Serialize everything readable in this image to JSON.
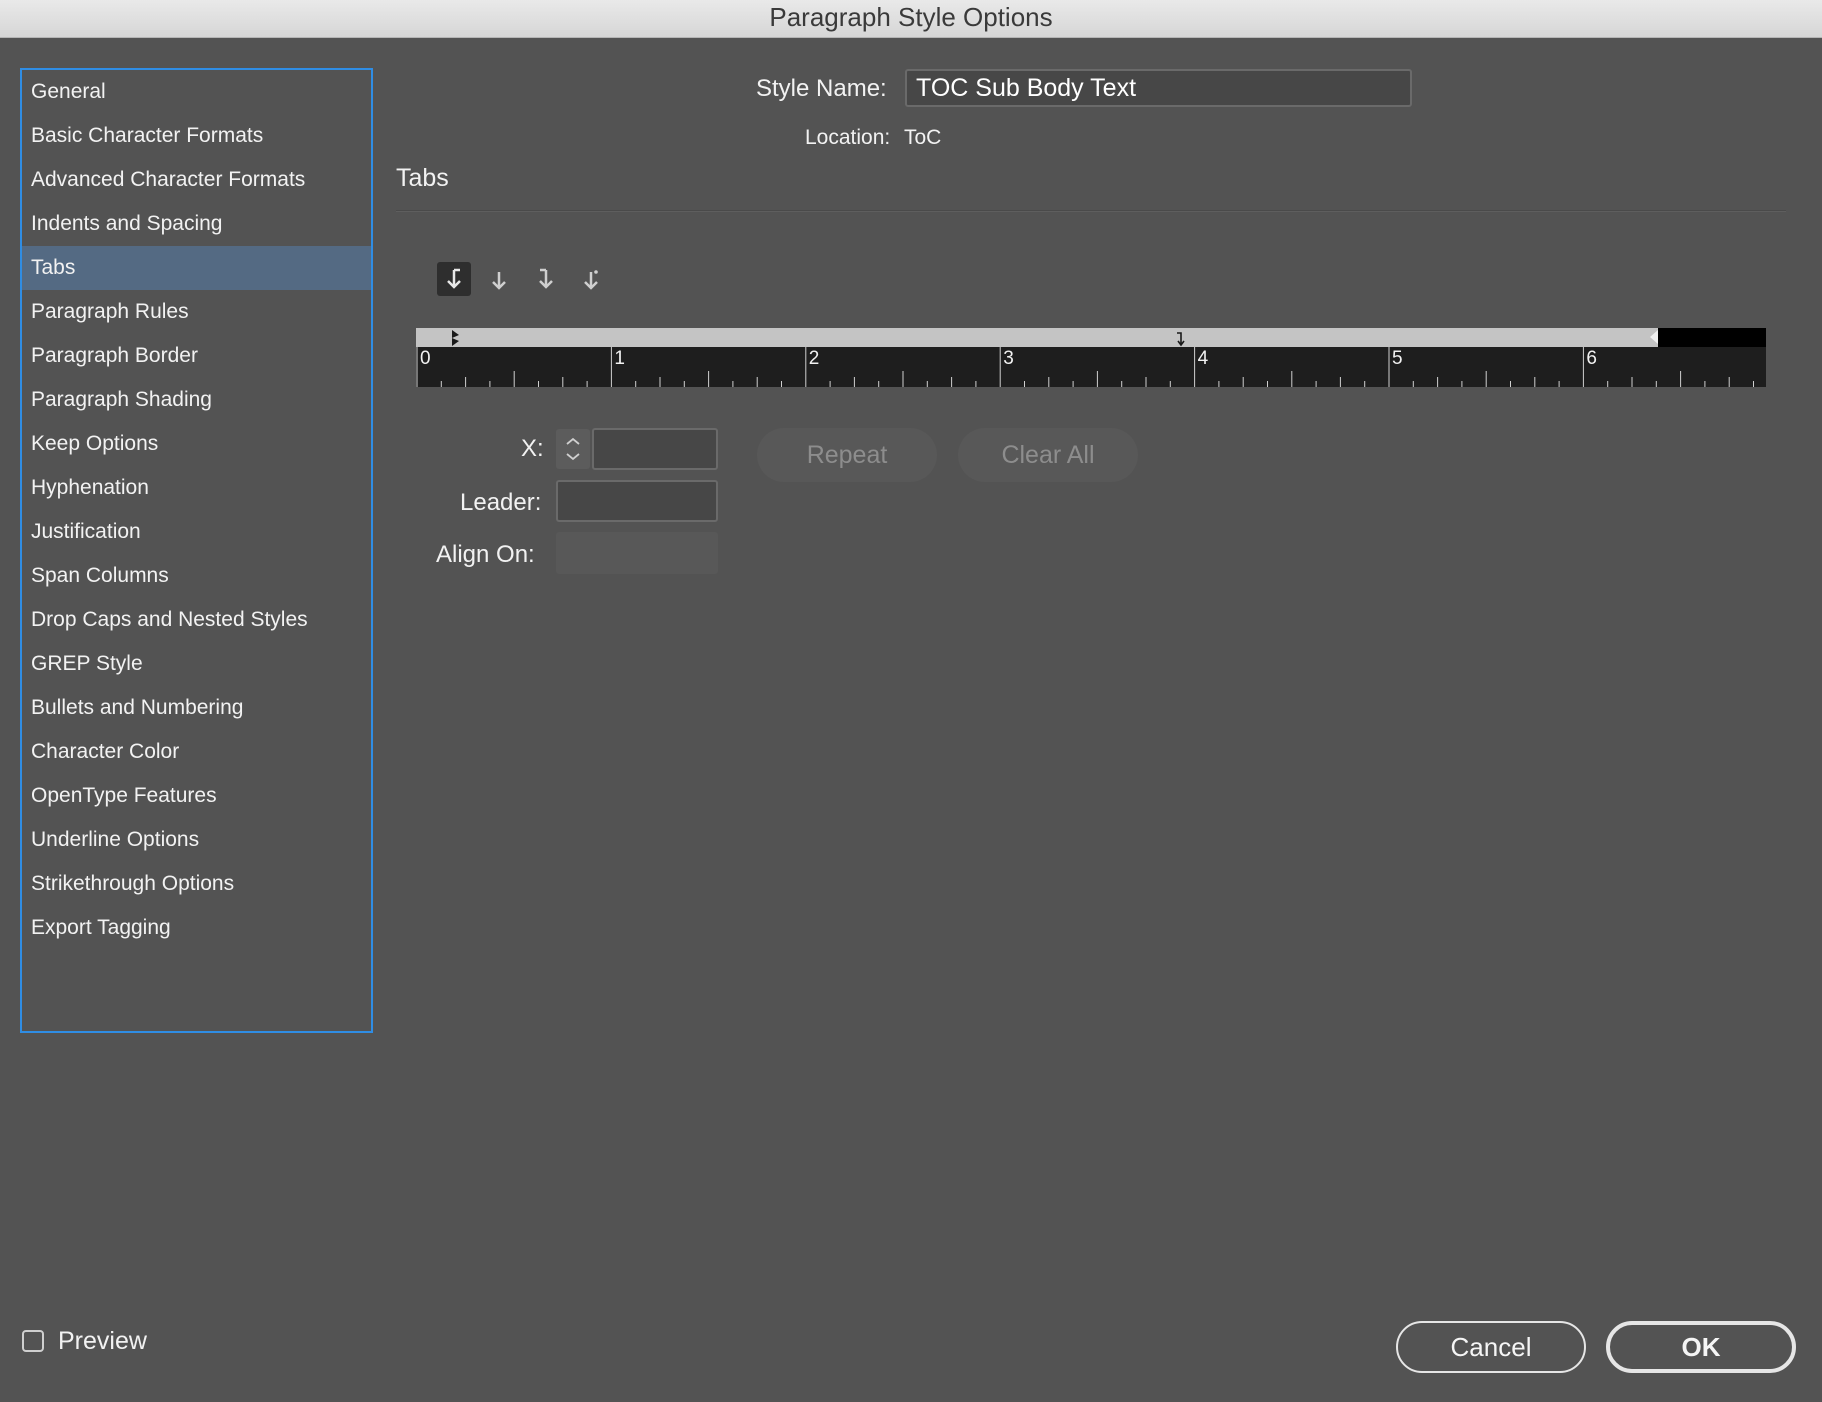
{
  "window": {
    "title": "Paragraph Style Options"
  },
  "sidebar": {
    "items": [
      {
        "label": "General"
      },
      {
        "label": "Basic Character Formats"
      },
      {
        "label": "Advanced Character Formats"
      },
      {
        "label": "Indents and Spacing"
      },
      {
        "label": "Tabs",
        "selected": true
      },
      {
        "label": "Paragraph Rules"
      },
      {
        "label": "Paragraph Border"
      },
      {
        "label": "Paragraph Shading"
      },
      {
        "label": "Keep Options"
      },
      {
        "label": "Hyphenation"
      },
      {
        "label": "Justification"
      },
      {
        "label": "Span Columns"
      },
      {
        "label": "Drop Caps and Nested Styles"
      },
      {
        "label": "GREP Style"
      },
      {
        "label": "Bullets and Numbering"
      },
      {
        "label": "Character Color"
      },
      {
        "label": "OpenType Features"
      },
      {
        "label": "Underline Options"
      },
      {
        "label": "Strikethrough Options"
      },
      {
        "label": "Export Tagging"
      }
    ]
  },
  "header": {
    "style_name_label": "Style Name:",
    "style_name_value": "TOC Sub Body Text",
    "location_label": "Location:",
    "location_value": "ToC"
  },
  "section": {
    "title": "Tabs"
  },
  "tab_alignment_buttons": [
    {
      "icon": "left-justified-tab-icon",
      "active": true
    },
    {
      "icon": "center-justified-tab-icon",
      "active": false
    },
    {
      "icon": "right-justified-tab-icon",
      "active": false
    },
    {
      "icon": "align-to-decimal-tab-icon",
      "active": false
    }
  ],
  "ruler": {
    "numbers": [
      "0",
      "1",
      "2",
      "3",
      "4",
      "5",
      "6"
    ]
  },
  "fields": {
    "x_label": "X:",
    "x_value": "",
    "leader_label": "Leader:",
    "leader_value": "",
    "align_on_label": "Align On:",
    "align_on_value": ""
  },
  "buttons": {
    "repeat": "Repeat",
    "clear_all": "Clear All",
    "cancel": "Cancel",
    "ok": "OK"
  },
  "preview": {
    "label": "Preview",
    "checked": false
  },
  "colors": {
    "background": "#535353",
    "selection": "#546a83",
    "focus_border": "#2f8de4"
  }
}
